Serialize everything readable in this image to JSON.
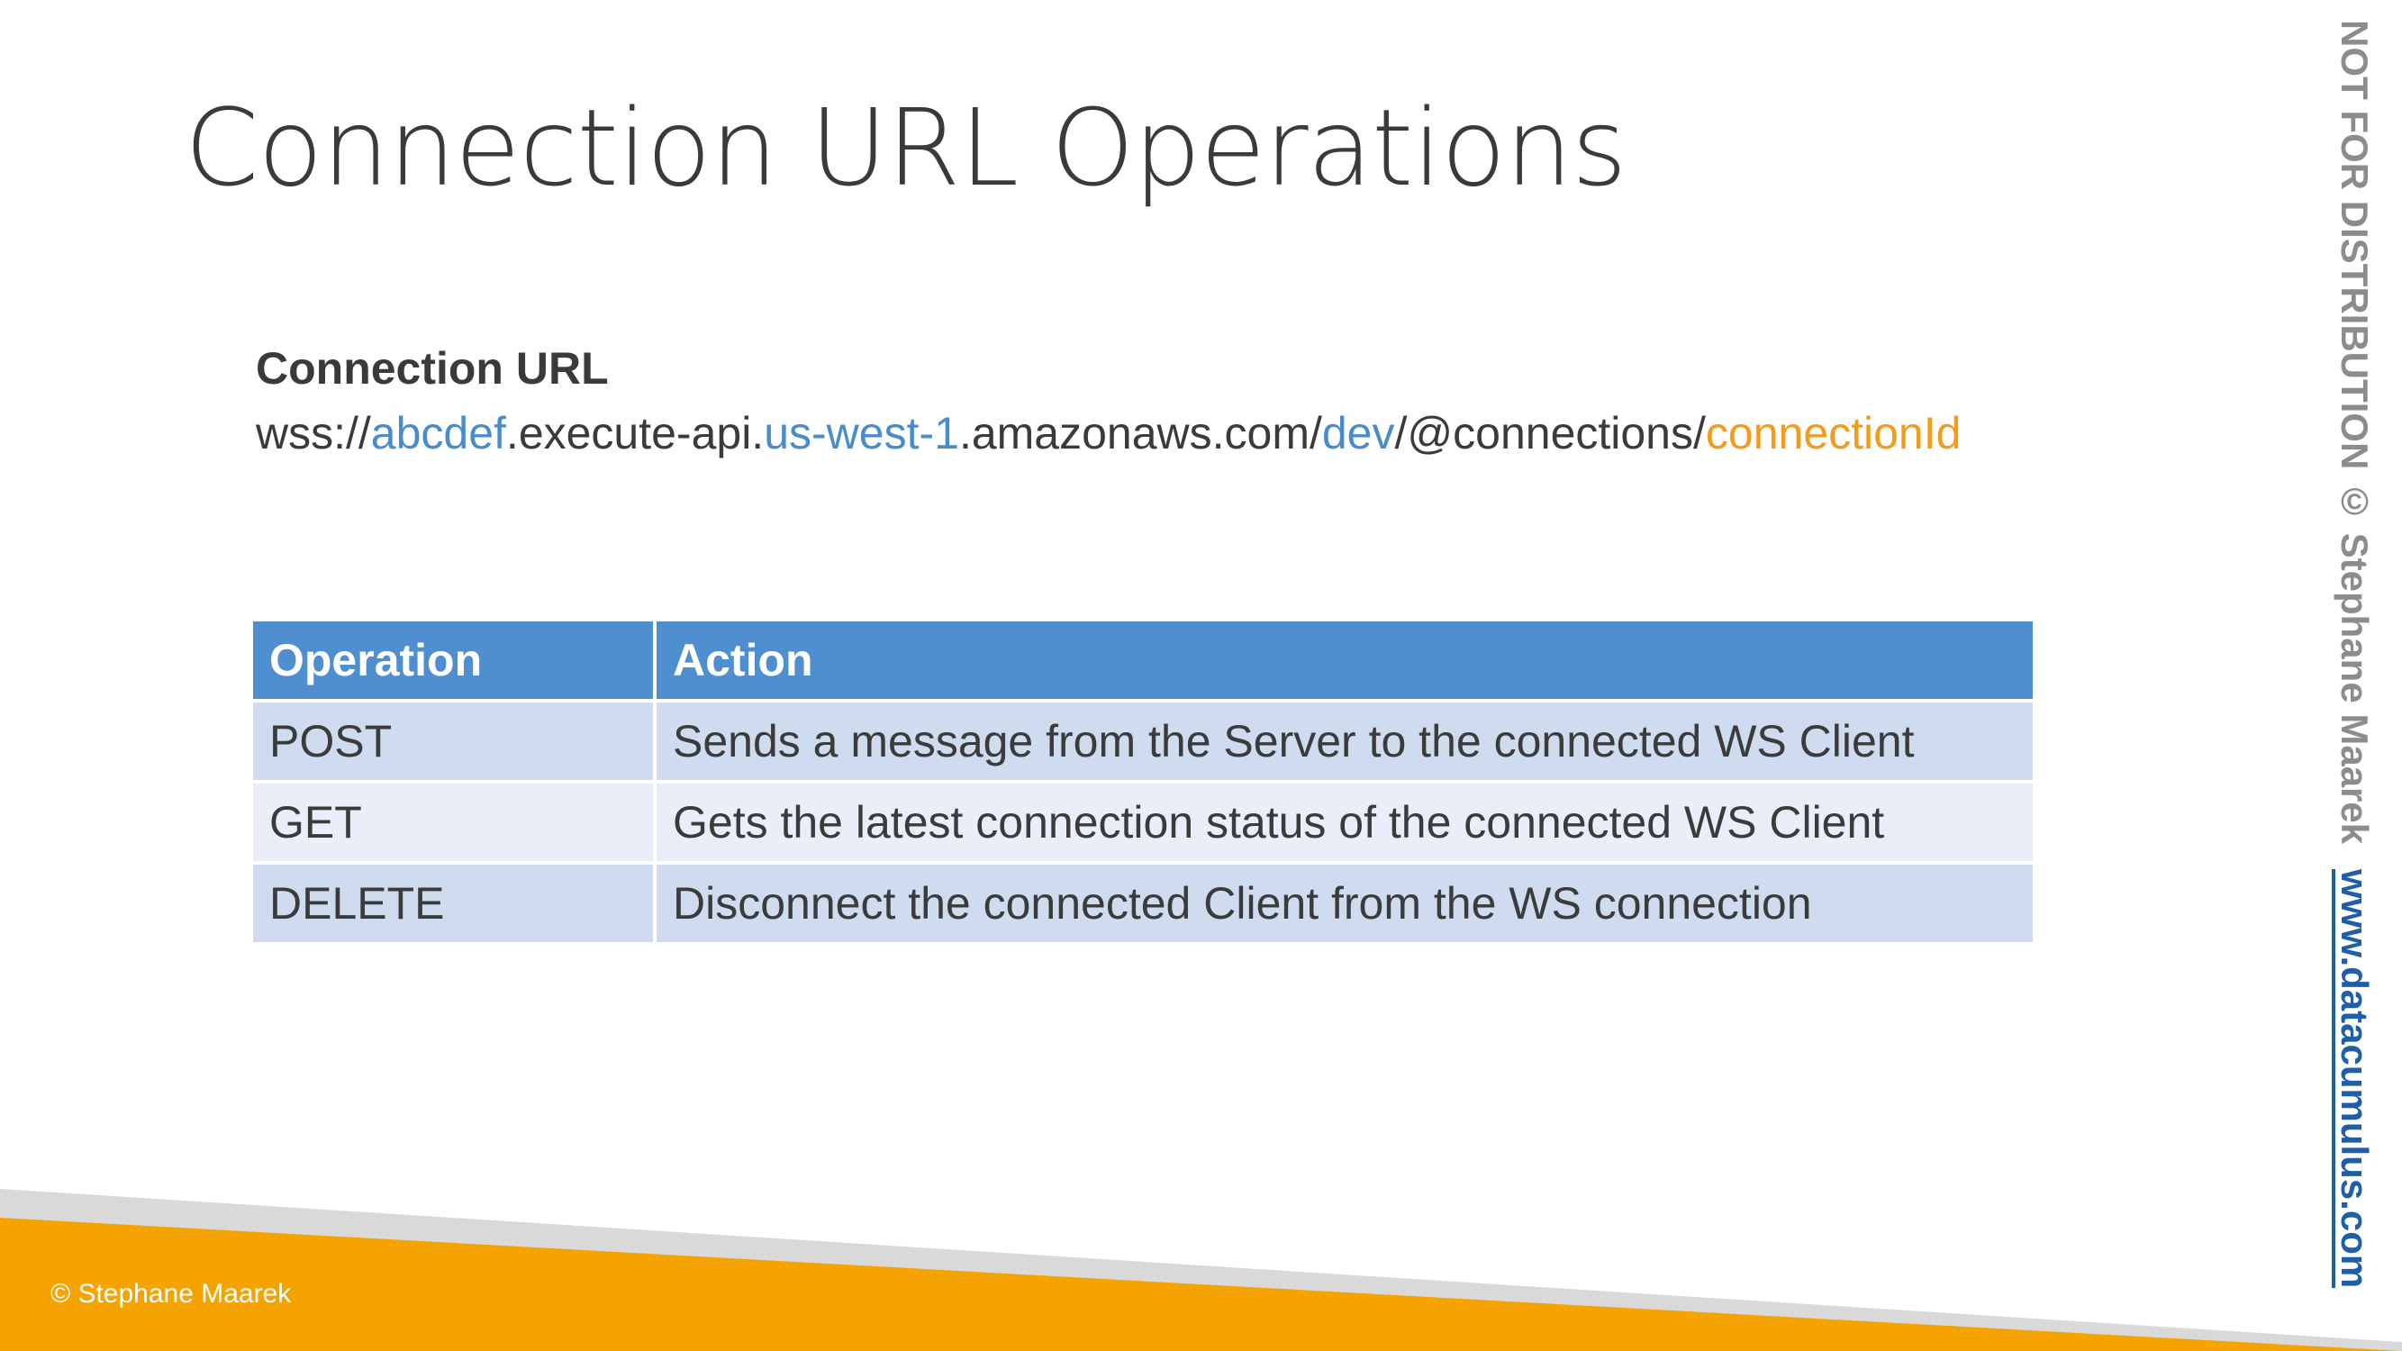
{
  "slide": {
    "title": "Connection URL Operations"
  },
  "connection": {
    "heading": "Connection URL",
    "url_segments": [
      {
        "text": "wss://",
        "color": "#3a3a3a"
      },
      {
        "text": "abcdef",
        "color": "#4a8bc9"
      },
      {
        "text": ".execute-api.",
        "color": "#3a3a3a"
      },
      {
        "text": "us-west-1",
        "color": "#4a8bc9"
      },
      {
        "text": ".amazonaws.com/",
        "color": "#3a3a3a"
      },
      {
        "text": "dev",
        "color": "#4a8bc9"
      },
      {
        "text": "/@connections/",
        "color": "#3a3a3a"
      },
      {
        "text": "connectionId",
        "color": "#f29c1e"
      }
    ]
  },
  "table": {
    "headers": [
      "Operation",
      "Action"
    ],
    "rows": [
      [
        "POST",
        "Sends a message from the Server to the connected WS Client"
      ],
      [
        "GET",
        "Gets the latest connection status of the connected WS Client"
      ],
      [
        "DELETE",
        "Disconnect the connected Client from the WS connection"
      ]
    ]
  },
  "watermark": {
    "text": "NOT FOR DISTRIBUTION © Stephane Maarek",
    "link": "www.datacumulus.com"
  },
  "footer": {
    "copyright": "© Stephane Maarek"
  },
  "colors": {
    "header_blue": "#4f8fd0",
    "accent_blue": "#4a8bc9",
    "accent_orange": "#f29c1e",
    "footer_orange": "#f5a300",
    "footer_gray": "#d9d9d9"
  }
}
